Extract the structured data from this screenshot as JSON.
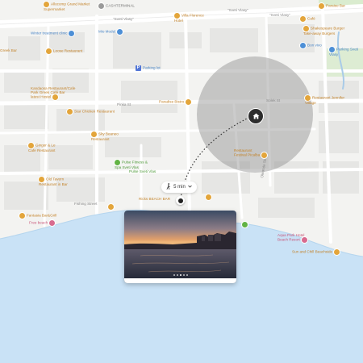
{
  "colors": {
    "water": "#c9e2f6",
    "land": "#f3f3f1",
    "road": "#ffffff",
    "building": "#e3e3e1",
    "park": "#cfe8c0",
    "radius": "#8e8e8e",
    "poi_orange": "#e3a53b",
    "poi_blue": "#4d8fd6",
    "poi_pink": "#d86b8f",
    "poi_green": "#62b344",
    "pin": "#2d2d2d"
  },
  "streets": {
    "sveti_vlasy_1": "\"Sveti Vlasy\"",
    "sveti_vlasy_2": "\"Sveti Vlasy\"",
    "sveti_vlasy_3": "\"Sveti Vlasy\"",
    "street_mid": "Pinka St",
    "street_small": "Solek St",
    "street_right": "Oleande Street",
    "fishing": "Fishing Street"
  },
  "pois": {
    "allocomp": "Allocomp Grand Market\nSupermarket",
    "cashterminal": "CASHTERMINAL",
    "villa_florence": "Villa Florence\nHotel",
    "cafe_top": "Café",
    "poi_rt1": "Paraiso Bar",
    "poi_rt2": "Shakespeare Burger\nTake-away Burgers",
    "poi_rt3": "Bon vivo",
    "parking_sveti": "Parking Sveti\nVlasy",
    "winter_treatment": "Winter treatment clinic",
    "mio_model": "Mio Model",
    "parking": "Parking lot",
    "loose_restaurant": "Loose Restaurant",
    "greek_bar": "Greek Bar",
    "poi_left2": "Kandaosa Restaurant/Cafe\nPark Greek Café Bar\nlatest Hostel",
    "ice_cream": "Ice cream shop",
    "star_chicken": "Star Chicken Restaurant",
    "paradise_bistro": "Paradise Bistro",
    "poi_jennifer": "Restaurant Jennifer\nVillage",
    "sky_beaneo": "Sky Beaneo\nRestaurant",
    "restaurant_pool": "Restaurant\nFestival Picalba",
    "ginger": "Ginger & Le\nCafe Restaurant",
    "pulse_fitness": "Pulse Fitness &\nSpa Sveti Vlas",
    "pulse_sub": "Pulse Sveti Vlas",
    "old_tavern": "Old Tavern\nRestaurant in Bar",
    "fantasia": "Fantasia Bar&Grill",
    "free_beach": "Free beach",
    "ricks_beach": "Ricks BEACH BAR",
    "aqua_park": "Aqua Park Hotel\nBeach Resort",
    "sun_beach": "Sun and Chill Beachside"
  },
  "walk_time": {
    "mode_icon": "walking-person-icon",
    "label": "5 min",
    "chevron": "chevron-down-icon"
  },
  "parking_symbol": "P",
  "photo": {
    "page_count": 5,
    "active_page": 3
  }
}
